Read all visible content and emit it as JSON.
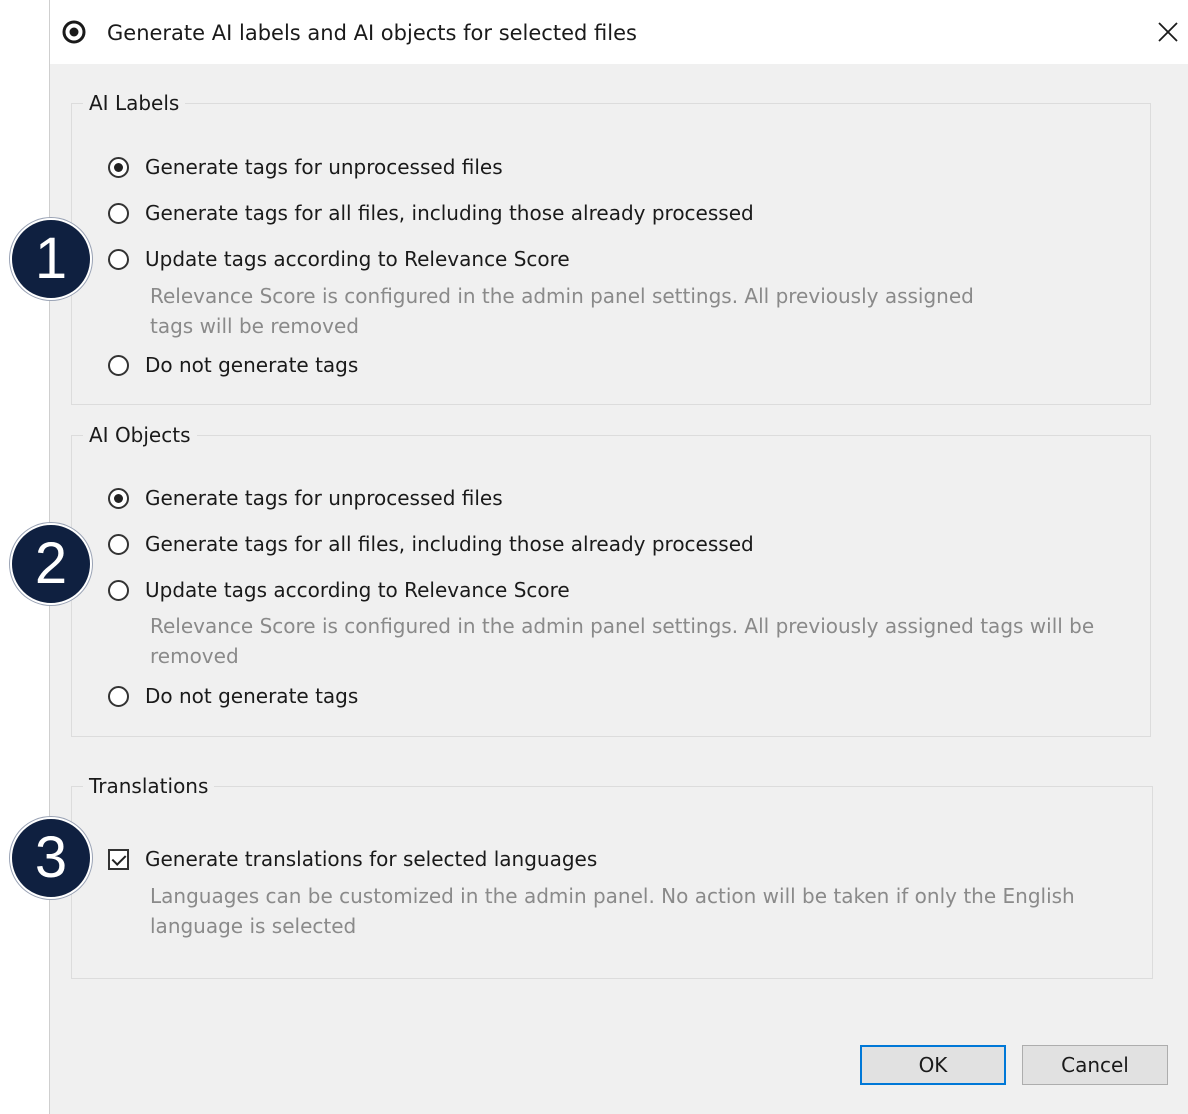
{
  "dialog": {
    "title": "Generate AI labels and AI objects for selected files",
    "close_glyph": "✕"
  },
  "ai_labels": {
    "legend": "AI Labels",
    "options": [
      {
        "label": "Generate tags for unprocessed files",
        "checked": true
      },
      {
        "label": "Generate tags for all files, including those already processed",
        "checked": false
      },
      {
        "label": "Update tags according to Relevance Score",
        "checked": false
      },
      {
        "label": "Do not generate tags",
        "checked": false
      }
    ],
    "relevance_desc_line1": "Relevance Score is configured in the admin panel settings. All previously assigned",
    "relevance_desc_line2": "tags will be removed"
  },
  "ai_objects": {
    "legend": "AI Objects",
    "options": [
      {
        "label": "Generate tags for unprocessed files",
        "checked": true
      },
      {
        "label": "Generate tags for all files, including those already processed",
        "checked": false
      },
      {
        "label": "Update tags according to Relevance Score",
        "checked": false
      },
      {
        "label": "Do not generate tags",
        "checked": false
      }
    ],
    "relevance_desc_line1": "Relevance Score is configured in the admin panel settings. All previously assigned tags will be",
    "relevance_desc_line2": "removed"
  },
  "translations": {
    "legend": "Translations",
    "checkbox_label": "Generate translations for selected languages",
    "checked": true,
    "desc_line1": "Languages can be customized in the admin panel. No action will be taken if only the English",
    "desc_line2": "language is selected"
  },
  "callouts": [
    "1",
    "2",
    "3"
  ],
  "buttons": {
    "ok": "OK",
    "cancel": "Cancel"
  },
  "colors": {
    "callout_bg": "#0f2040",
    "dialog_bg": "#f0f0f0",
    "default_button_border": "#0078d7"
  },
  "icons": {
    "app": "target-logo-icon",
    "close": "close-icon"
  }
}
